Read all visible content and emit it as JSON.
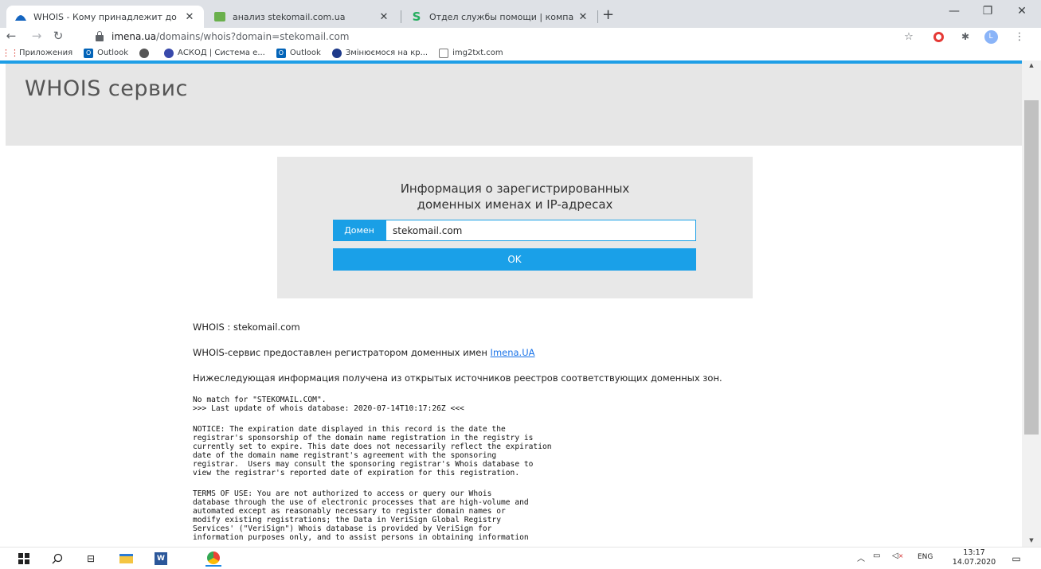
{
  "browser": {
    "tabs": [
      {
        "title": "WHOIS - Кому принадлежит до",
        "active": true
      },
      {
        "title": "анализ stekomail.com.ua",
        "active": false
      },
      {
        "title": "Отдел службы помощи | компа",
        "active": false
      }
    ],
    "new_tab": "+",
    "window_controls": {
      "minimize": "—",
      "maximize": "❐",
      "close": "✕"
    },
    "url_host": "imena.ua",
    "url_path": "/domains/whois?domain=stekomail.com",
    "profile_initial": "L",
    "bookmarks": [
      {
        "label": "Приложения",
        "icon": "apps-grid-icon"
      },
      {
        "label": "Outlook",
        "icon": "outlook-icon"
      },
      {
        "label": "",
        "icon": "chrome-icon"
      },
      {
        "label": "АСКОД | Система е...",
        "icon": "askod-icon"
      },
      {
        "label": "Outlook",
        "icon": "outlook-icon"
      },
      {
        "label": "Змінюємося на кр...",
        "icon": "globe-icon"
      },
      {
        "label": "img2txt.com",
        "icon": "img2txt-icon"
      }
    ]
  },
  "page": {
    "hero_title": "WHOIS сервис",
    "search": {
      "caption_line1": "Информация о зарегистрированных",
      "caption_line2": "доменных именах и IP-адресах",
      "domain_label": "Домен",
      "domain_value": "stekomail.com",
      "ok_label": "OK"
    },
    "result": {
      "whois_line": "WHOIS : stekomail.com",
      "provided_text": "WHOIS-сервис предоставлен регистратором доменных имен ",
      "provided_link": "Imena.UA",
      "info_line": "Нижеследующая информация получена из открытых источников реестров соответствующих доменных зон.",
      "raw_block1": "No match for \"STEKOMAIL.COM\".\n>>> Last update of whois database: 2020-07-14T10:17:26Z <<<",
      "raw_block2": "NOTICE: The expiration date displayed in this record is the date the\nregistrar's sponsorship of the domain name registration in the registry is\ncurrently set to expire. This date does not necessarily reflect the expiration\ndate of the domain name registrant's agreement with the sponsoring\nregistrar.  Users may consult the sponsoring registrar's Whois database to\nview the registrar's reported date of expiration for this registration.",
      "raw_block3": "TERMS OF USE: You are not authorized to access or query our Whois\ndatabase through the use of electronic processes that are high-volume and\nautomated except as reasonably necessary to register domain names or\nmodify existing registrations; the Data in VeriSign Global Registry\nServices' (\"VeriSign\") Whois database is provided by VeriSign for\ninformation purposes only, and to assist persons in obtaining information"
    }
  },
  "taskbar": {
    "language": "ENG",
    "time": "13:17",
    "date": "14.07.2020"
  },
  "colors": {
    "accent": "#1a9fe6",
    "hero_bg": "#e6e6e6",
    "searchbox_bg": "#e8e8e8"
  }
}
